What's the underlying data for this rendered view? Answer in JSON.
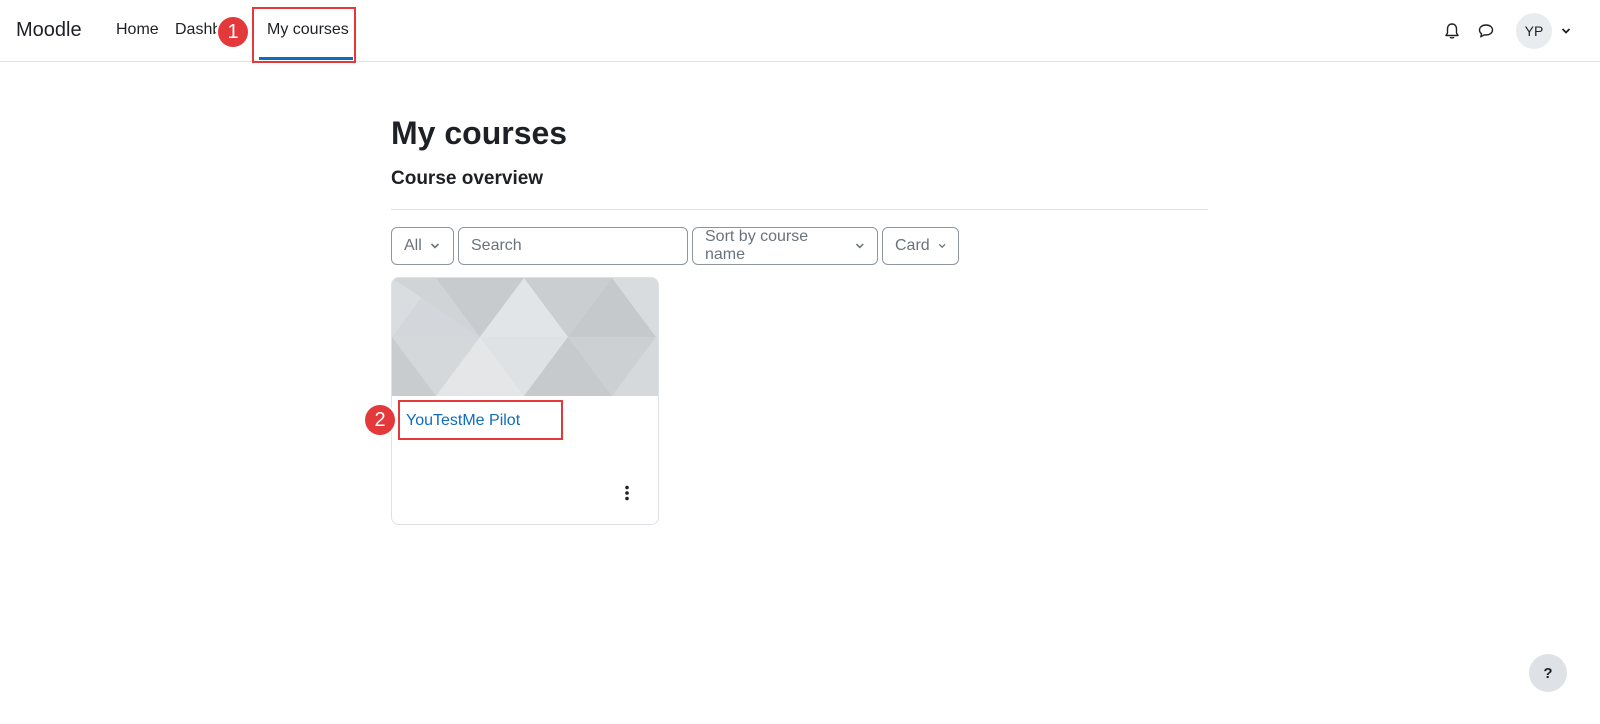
{
  "navbar": {
    "brand": "Moodle",
    "links": [
      {
        "label": "Home"
      },
      {
        "label": "Dashb"
      },
      {
        "label": "My courses",
        "active": true
      }
    ],
    "user_initials": "YP"
  },
  "annotations": [
    {
      "number": "1",
      "target": "My courses"
    },
    {
      "number": "2",
      "target": "YouTestMe Pilot"
    }
  ],
  "page": {
    "title": "My courses",
    "section_title": "Course overview"
  },
  "filters": {
    "grouping": "All",
    "search_placeholder": "Search",
    "search_value": "",
    "sort": "Sort by course name",
    "view": "Card"
  },
  "courses": [
    {
      "name": "YouTestMe Pilot"
    }
  ],
  "help": {
    "label": "?"
  },
  "colors": {
    "accent": "#0f6cbf",
    "annotation": "#e4393b",
    "text": "#1d2125",
    "muted": "#6a737b"
  },
  "icons": [
    "bell-icon",
    "chat-icon",
    "chevron-down-icon",
    "kebab-menu-icon",
    "question-icon"
  ]
}
